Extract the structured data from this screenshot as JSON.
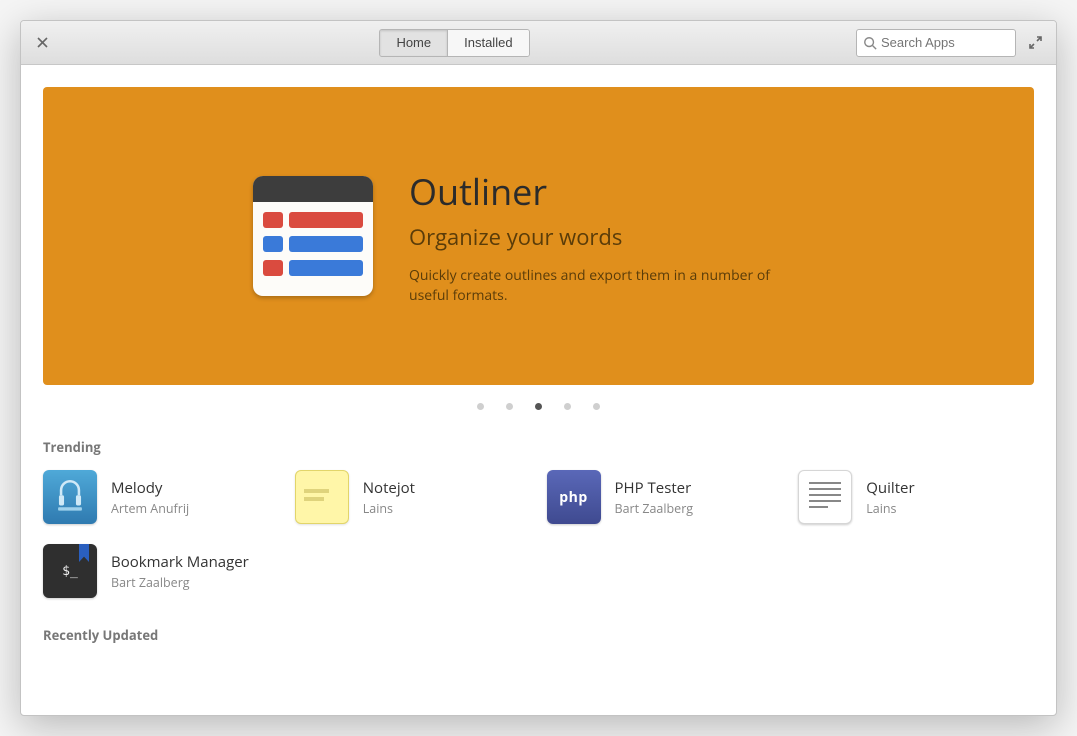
{
  "titlebar": {
    "tabs": {
      "home": "Home",
      "installed": "Installed"
    },
    "search_placeholder": "Search Apps"
  },
  "hero": {
    "title": "Outliner",
    "subtitle": "Organize your words",
    "description": "Quickly create outlines and export them in a number of useful formats.",
    "active_dot": 2,
    "dot_count": 5
  },
  "sections": {
    "trending_label": "Trending",
    "recently_updated_label": "Recently Updated"
  },
  "trending": [
    {
      "name": "Melody",
      "author": "Artem Anufrij",
      "icon": "melody"
    },
    {
      "name": "Notejot",
      "author": "Lains",
      "icon": "notejot"
    },
    {
      "name": "PHP Tester",
      "author": "Bart Zaalberg",
      "icon": "php"
    },
    {
      "name": "Quilter",
      "author": "Lains",
      "icon": "quilter"
    },
    {
      "name": "Bookmark Manager",
      "author": "Bart Zaalberg",
      "icon": "bookmark"
    }
  ]
}
